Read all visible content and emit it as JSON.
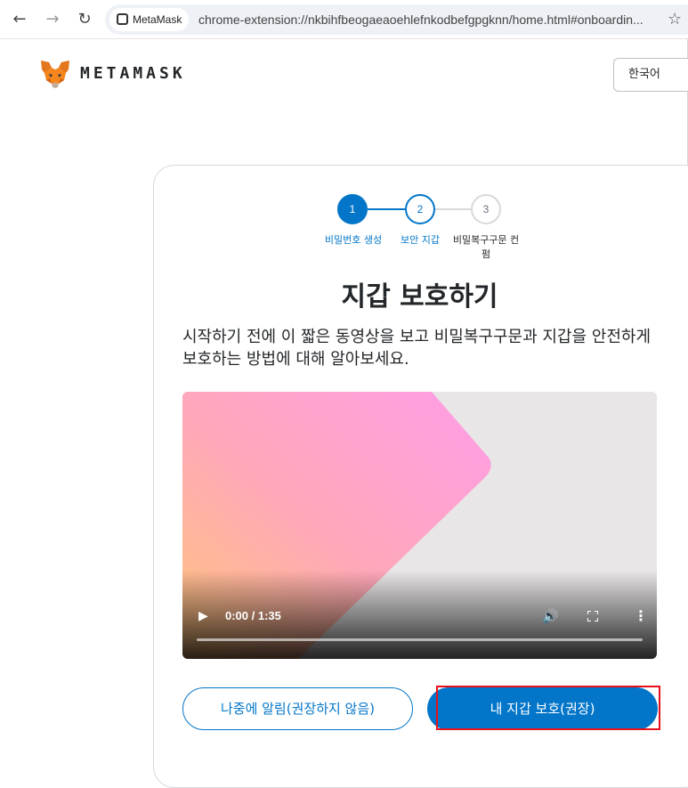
{
  "browser": {
    "site_chip": "MetaMask",
    "url": "chrome-extension://nkbihfbeogaeaoehlefnkodbefgpgknn/home.html#onboardin..."
  },
  "header": {
    "wordmark": "METAMASK",
    "language": "한국어"
  },
  "stepper": {
    "steps": [
      {
        "number": "1",
        "label": "비밀번호 생성"
      },
      {
        "number": "2",
        "label": "보안 지갑"
      },
      {
        "number": "3",
        "label": "비밀복구구문 컨펌"
      }
    ]
  },
  "main": {
    "title": "지갑 보호하기",
    "description": "시작하기 전에 이 짧은 동영상을 보고 비밀복구구문과 지갑을 안전하게 보호하는 방법에 대해 알아보세요."
  },
  "video": {
    "time": "0:00 / 1:35",
    "progress": 0
  },
  "actions": {
    "secondary_label": "나중에 알림(권장하지 않음)",
    "primary_label": "내 지갑 보호(권장)"
  },
  "colors": {
    "accent": "#0376c9",
    "highlight": "#e8101b"
  }
}
